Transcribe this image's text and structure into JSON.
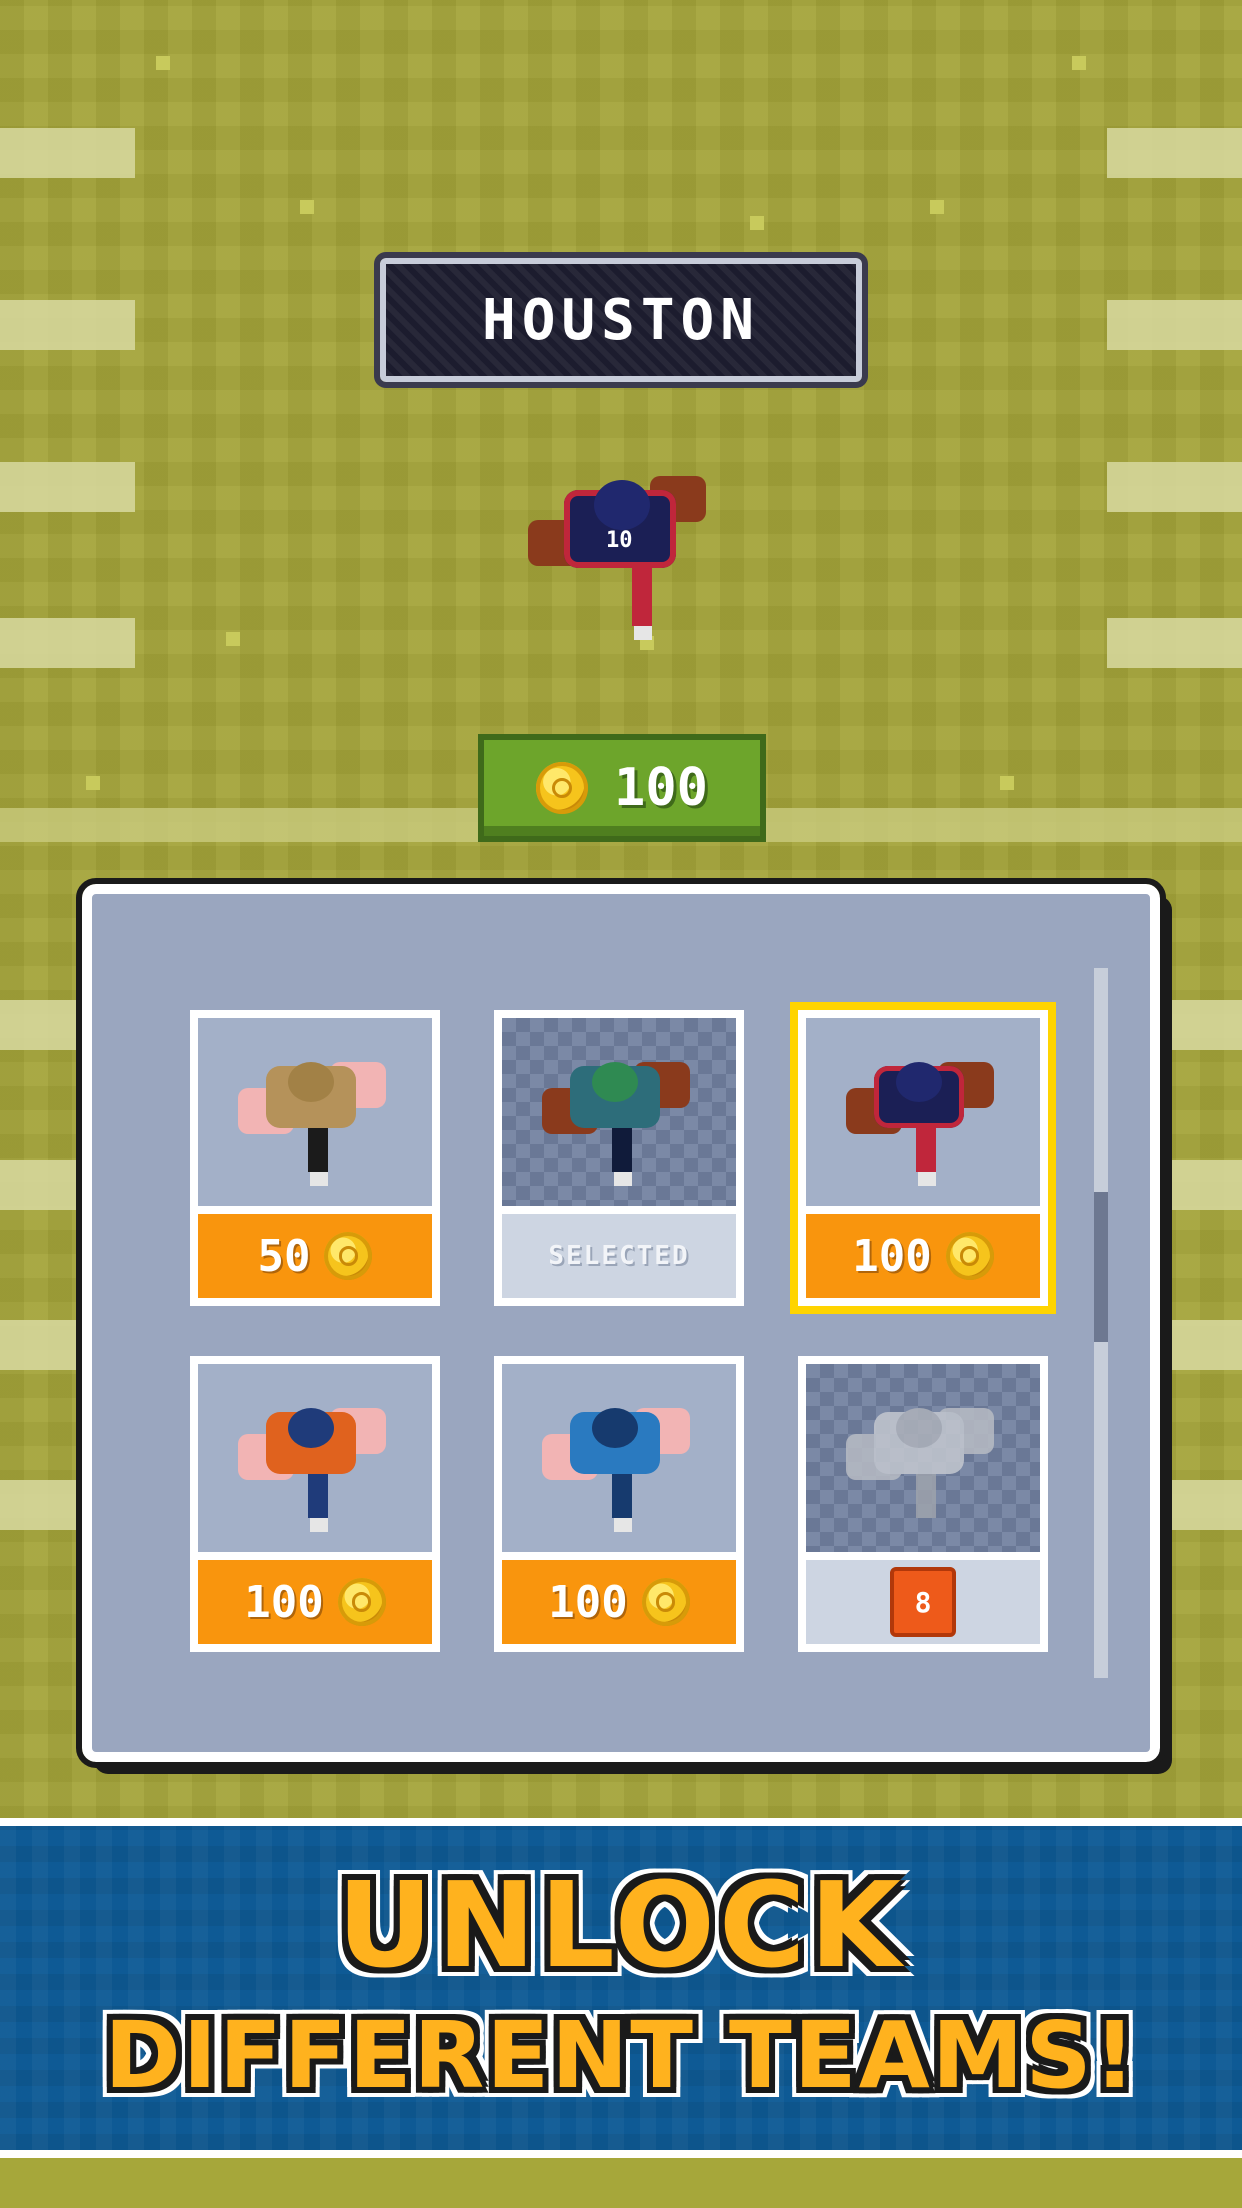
{
  "header": {
    "team_name": "HOUSTON"
  },
  "balance": {
    "icon": "coin-icon",
    "amount": "100"
  },
  "team_cards": [
    {
      "team": "tan-gold",
      "price": "50",
      "state": "buy"
    },
    {
      "team": "green-navy",
      "status": "SELECTED",
      "state": "selected"
    },
    {
      "team": "houston",
      "price": "100",
      "state": "buy",
      "highlighted": true
    },
    {
      "team": "orange-blue",
      "price": "100",
      "state": "buy"
    },
    {
      "team": "light-blue",
      "price": "100",
      "state": "buy"
    },
    {
      "team": "locked",
      "lock_level": "8",
      "state": "locked"
    }
  ],
  "promo": {
    "line1": "UNLOCK",
    "line2": "DIFFERENT TEAMS!"
  },
  "colors": {
    "field": "#a4a43a",
    "price_orange": "#f9950d",
    "highlight_yellow": "#ffd400",
    "banner_blue": "#0e5a95",
    "promo_text": "#ffb21e"
  }
}
